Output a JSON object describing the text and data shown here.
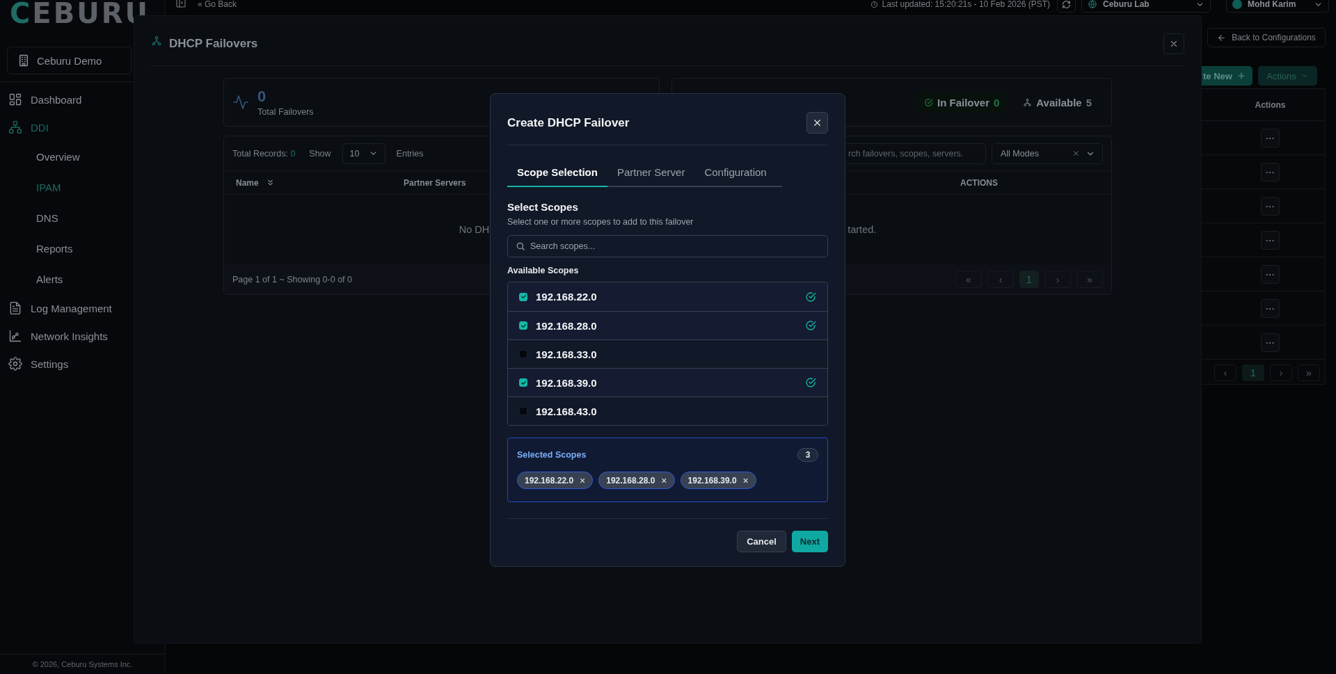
{
  "topbar": {
    "logo": "CEBURU",
    "back_link": "« Go Back",
    "last_updated": "Last updated: 15:20:21s - 10 Feb 2026 (PST)",
    "workspace": "Ceburu Lab",
    "user": "Mohd Karim"
  },
  "sidebar": {
    "org": "Ceburu Demo",
    "items": [
      {
        "label": "Dashboard",
        "selected": false
      },
      {
        "label": "DDI",
        "selected": true,
        "children": [
          {
            "label": "Overview",
            "selected": false
          },
          {
            "label": "IPAM",
            "selected": true
          },
          {
            "label": "DNS",
            "selected": false
          },
          {
            "label": "Reports",
            "selected": false
          },
          {
            "label": "Alerts",
            "selected": false
          }
        ]
      },
      {
        "label": "Log Management",
        "selected": false
      },
      {
        "label": "Network Insights",
        "selected": false
      },
      {
        "label": "Settings",
        "selected": false
      }
    ],
    "footer": "© 2026, Ceburu Systems Inc."
  },
  "background_page": {
    "back_button": "Back to Configurations",
    "create_button": "te New",
    "actions_button": "Actions",
    "column": "Actions",
    "rows": [
      {
        "menu": "···"
      },
      {
        "menu": "···"
      },
      {
        "menu": "···"
      },
      {
        "menu": "···"
      },
      {
        "menu": "···"
      },
      {
        "menu": "···"
      },
      {
        "menu": "···"
      }
    ],
    "pages": [
      {
        "label": "‹",
        "selected": false
      },
      {
        "label": "1",
        "selected": true
      },
      {
        "label": "›",
        "selected": false
      },
      {
        "label": "»",
        "selected": false
      }
    ]
  },
  "drawer": {
    "title": "DHCP Failovers",
    "total": {
      "value": "0",
      "label": "Total Failovers"
    },
    "badges": [
      {
        "kind": "success",
        "label": "In Failover",
        "value": "0"
      },
      {
        "kind": "neutral",
        "label": "Available",
        "value": "5"
      }
    ],
    "table": {
      "total_records_label": "Total Records:",
      "total_records": "0",
      "show_label": "Show",
      "page_size": "10",
      "entries_label": "Entries",
      "search_placeholder": "rch failovers, scopes, servers.",
      "mode_filter": "All Modes",
      "columns": [
        "Name",
        "Partner Servers",
        "ACTIONS"
      ],
      "empty_message_parts": [
        "No DH",
        "tarted."
      ],
      "footer": "Page 1 of 1 ~ Showing 0-0 of 0",
      "pages": [
        {
          "label": "«",
          "selected": false
        },
        {
          "label": "‹",
          "selected": false
        },
        {
          "label": "1",
          "selected": true
        },
        {
          "label": "›",
          "selected": false
        },
        {
          "label": "»",
          "selected": false
        }
      ]
    }
  },
  "modal": {
    "title": "Create DHCP Failover",
    "tabs": [
      {
        "label": "Scope Selection",
        "selected": true
      },
      {
        "label": "Partner Server",
        "selected": false
      },
      {
        "label": "Configuration",
        "selected": false
      }
    ],
    "section_title": "Select Scopes",
    "section_hint": "Select one or more scopes to add to this failover",
    "search_placeholder": "Search scopes...",
    "list_label": "Available Scopes",
    "scopes": [
      {
        "address": "192.168.22.0",
        "checked": true
      },
      {
        "address": "192.168.28.0",
        "checked": true
      },
      {
        "address": "192.168.33.0",
        "checked": false
      },
      {
        "address": "192.168.39.0",
        "checked": true
      },
      {
        "address": "192.168.43.0",
        "checked": false
      }
    ],
    "selected_title": "Selected Scopes",
    "selected_count": "3",
    "chips": [
      {
        "label": "192.168.22.0",
        "remove": "×"
      },
      {
        "label": "192.168.28.0",
        "remove": "×"
      },
      {
        "label": "192.168.39.0",
        "remove": "×"
      }
    ],
    "cancel_button": "Cancel",
    "next_button": "Next"
  }
}
